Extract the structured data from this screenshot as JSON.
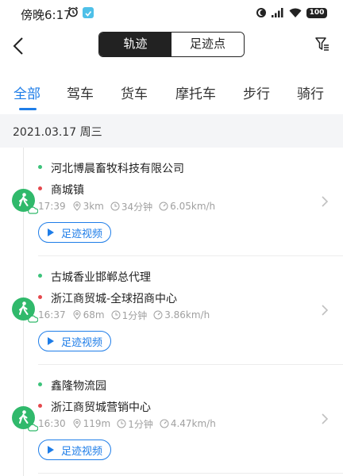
{
  "status_bar": {
    "time": "傍晚6:17",
    "battery": "100"
  },
  "header": {
    "segments": [
      "轨迹",
      "足迹点"
    ],
    "active_segment": 0
  },
  "tabs": [
    "全部",
    "驾车",
    "货车",
    "摩托车",
    "步行",
    "骑行"
  ],
  "active_tab": 0,
  "date_label": "2021.03.17 周三",
  "records": [
    {
      "from": "河北博晨畜牧科技有限公司",
      "to": "商城镇",
      "time": "17:39",
      "distance": "3km",
      "duration": "34分钟",
      "speed": "6.05km/h",
      "button": "足迹视频"
    },
    {
      "from": "古城香业邯郸总代理",
      "to": "浙江商贸城-全球招商中心",
      "time": "16:37",
      "distance": "68m",
      "duration": "1分钟",
      "speed": "3.86km/h",
      "button": "足迹视频"
    },
    {
      "from": "鑫隆物流园",
      "to": "浙江商贸城营销中心",
      "time": "16:30",
      "distance": "119m",
      "duration": "1分钟",
      "speed": "4.47km/h",
      "button": "足迹视频"
    }
  ],
  "colors": {
    "accent": "#1e7de8",
    "walk_green": "#30b96b",
    "start_dot": "#3cc37a",
    "end_dot": "#e5484d"
  }
}
